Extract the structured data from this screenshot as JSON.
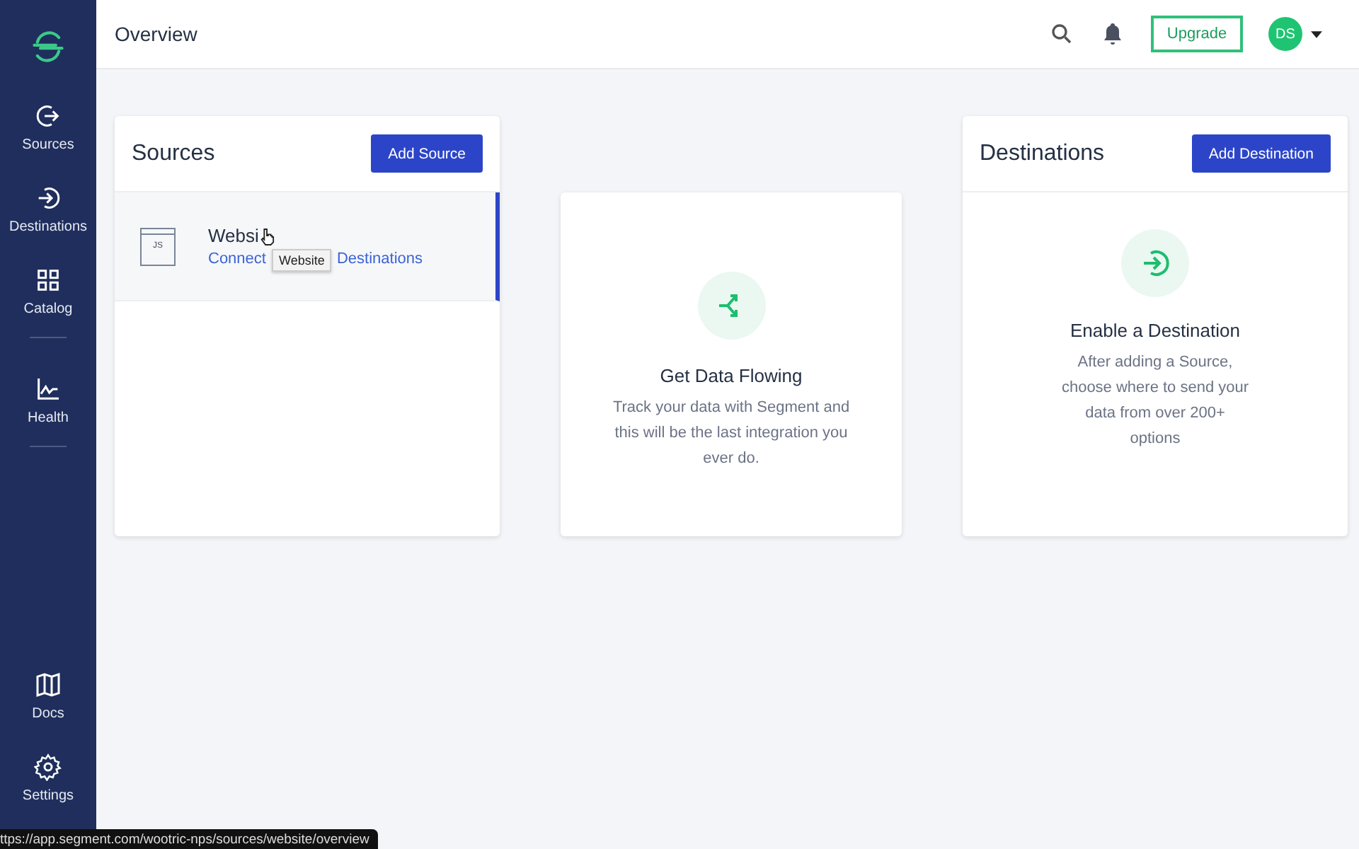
{
  "sidebar": {
    "items": [
      {
        "label": "Sources",
        "kind": "sources",
        "selected": false
      },
      {
        "label": "Destinations",
        "kind": "destinations",
        "selected": false
      },
      {
        "label": "Catalog",
        "kind": "catalog",
        "selected": false
      },
      {
        "label": "Health",
        "kind": "health",
        "selected": false
      }
    ],
    "bottom_items": [
      {
        "label": "Docs",
        "kind": "docs"
      },
      {
        "label": "Settings",
        "kind": "settings"
      }
    ]
  },
  "header": {
    "title": "Overview",
    "upgrade_button": "Upgrade",
    "avatar": "DS"
  },
  "sources": {
    "title": "Sources",
    "button": "Add Source",
    "items": [
      {
        "title": "Websi",
        "logo": "JS",
        "link_parts": [
          "Connect",
          "Destinations"
        ],
        "selected": true,
        "tooltip": "Website"
      }
    ]
  },
  "flow_card": {
    "title": "Get Data Flowing",
    "text": "Track your data with Segment and this will be the last integration you ever do."
  },
  "destinations": {
    "title": "Destinations",
    "button": "Add Destination",
    "empty_title": "Enable a Destination",
    "empty_text": "After adding a Source, choose where to send your data from over 200+ options"
  },
  "status_bar": {
    "url": "ttps://app.segment.com/wootric-nps/sources/website/overview"
  }
}
